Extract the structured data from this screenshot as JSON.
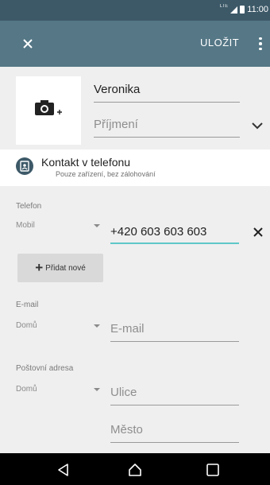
{
  "status_bar": {
    "network": "LTE",
    "time": "11:00"
  },
  "app_bar": {
    "save_label": "ULOŽIT"
  },
  "contact": {
    "first_name": "Veronika",
    "last_name_placeholder": "Příjmení"
  },
  "account": {
    "title": "Kontakt v telefonu",
    "subtitle": "Pouze zařízení, bez zálohování"
  },
  "phone": {
    "label": "Telefon",
    "type": "Mobil",
    "value": "+420 603 603 603"
  },
  "add_new_label": "Přidat nové",
  "email": {
    "label": "E-mail",
    "type": "Domů",
    "placeholder": "E-mail"
  },
  "address": {
    "label": "Poštovní adresa",
    "type": "Domů",
    "street_placeholder": "Ulice",
    "city_placeholder": "Město"
  },
  "colors": {
    "status_bar": "#3d5968",
    "app_bar": "#557786",
    "accent_underline": "#5fc8c8"
  },
  "icons": [
    "close-icon",
    "more-vert-icon",
    "camera-add-icon",
    "chevron-down-icon",
    "contact-card-icon",
    "back-icon",
    "home-icon",
    "recents-icon"
  ]
}
